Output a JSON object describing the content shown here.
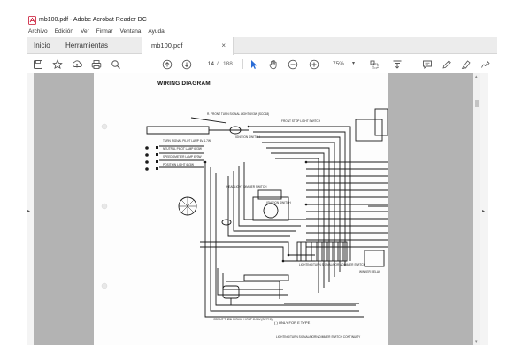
{
  "window": {
    "title": "mb100.pdf - Adobe Acrobat Reader DC"
  },
  "menu": [
    "Archivo",
    "Edición",
    "Ver",
    "Firmar",
    "Ventana",
    "Ayuda"
  ],
  "tabs": {
    "home": "Inicio",
    "tools": "Herramientas",
    "document": "mb100.pdf",
    "close": "×"
  },
  "toolbar": {
    "current_page": "14",
    "page_separator": "/",
    "total_pages": "188",
    "zoom": "75%",
    "icons": [
      "save-icon",
      "star-icon",
      "upload-icon",
      "print-icon",
      "search-icon",
      "page-up-icon",
      "page-down-icon",
      "select-cursor-icon",
      "hand-icon",
      "zoom-out-icon",
      "zoom-in-icon",
      "zoom-dropdown-icon",
      "crop-icon",
      "scroll-mode-icon",
      "comment-icon",
      "pen-icon",
      "highlight-icon",
      "sign-icon"
    ]
  },
  "document": {
    "heading": "WIRING DIAGRAM",
    "labels": {
      "front_turn_signal": "R. FRONT TURN SIGNAL LIGHT 6V3W (SCC18)",
      "front_stop_switch": "FRONT STOP LIGHT SWITCH",
      "ignition": "IGNITION SWITCH",
      "turn_signal_pilot": "TURN SIGNAL PILOT LAMP 6V 1.7W",
      "neutral_pilot": "NEUTRAL PILOT LAMP 6V3W",
      "speedometer": "SPEEDOMETER LAMP 6V3W",
      "position_light": "POSITION LIGHT 6V3W",
      "headlight_dimmer": "HEADLIGHT DIMMER SWITCH",
      "ignition_switch_lower": "IGNITION SWITCH",
      "lighting_switch": "LIGHTING/TURN SIGNAL/HORN/DIMMER SWITCH",
      "winker_relay": "WINKER RELAY",
      "rear_turn_signal": "L. FRONT TURN SIGNAL LIGHT 6V3W (SCC18)",
      "legend": "( ) ONLY FOR E TYPE",
      "footer": "LIGHTING/TURN SIGNAL/HORN/DIMMER SWITCH CONTINUITY"
    }
  },
  "colors": {
    "accent_blue": "#2a6cd6",
    "page_gray": "#b3b3b3",
    "tab_bg": "#ececec"
  }
}
